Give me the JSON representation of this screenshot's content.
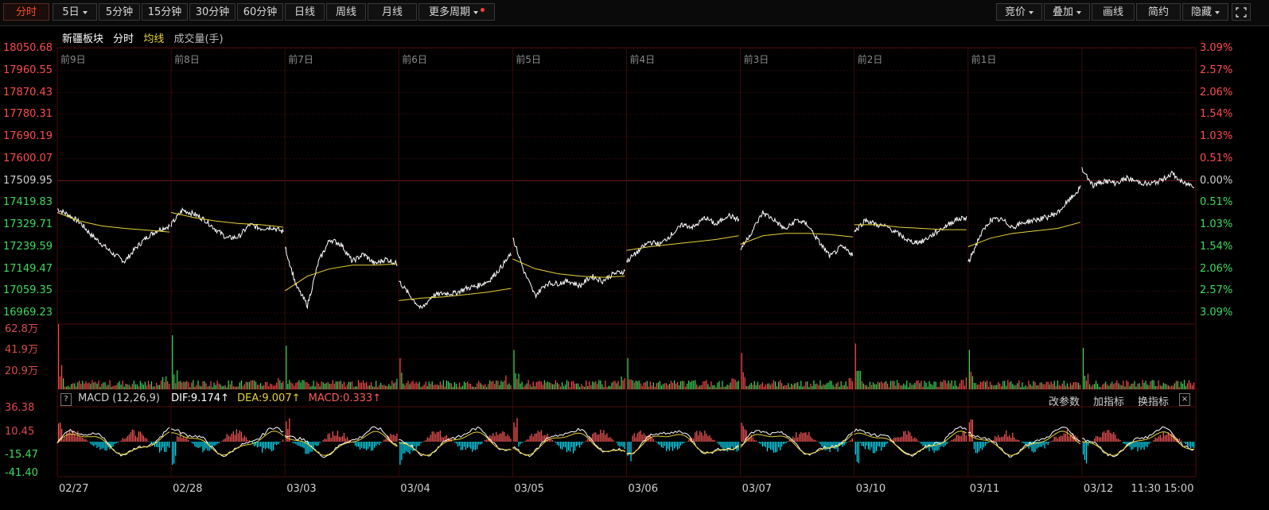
{
  "toolbar": {
    "periods": [
      "分时",
      "5日",
      "5分钟",
      "15分钟",
      "30分钟",
      "60分钟",
      "日线",
      "周线",
      "月线",
      "更多周期"
    ],
    "active": "分时",
    "right": [
      "竞价",
      "叠加",
      "画线",
      "简约",
      "隐藏"
    ],
    "fullscreen_icon": "expand-icon"
  },
  "legend": {
    "name": "新疆板块",
    "mode": "分时",
    "avg": "均线",
    "vol": "成交量(手)"
  },
  "colors": {
    "up": "#ff4d4d",
    "down": "#3ddc5a",
    "price": "#ffffff",
    "avg": "#e8d23a",
    "dif": "#ffffff",
    "dea": "#e8d23a",
    "macd_up": "#ff5a5a",
    "macd_down": "#00e5ff",
    "grid": "#3a0a0a"
  },
  "price_axis": {
    "left": [
      "18050.68",
      "17960.55",
      "17870.43",
      "17780.31",
      "17690.19",
      "17600.07",
      "17509.95",
      "17419.83",
      "17329.71",
      "17239.59",
      "17149.47",
      "17059.35",
      "16969.23"
    ],
    "right": [
      "3.09%",
      "2.57%",
      "2.06%",
      "1.54%",
      "1.03%",
      "0.51%",
      "0.00%",
      "0.51%",
      "1.03%",
      "1.54%",
      "2.06%",
      "2.57%",
      "3.09%"
    ]
  },
  "day_labels": [
    "前9日",
    "前8日",
    "前7日",
    "前6日",
    "前5日",
    "前4日",
    "前3日",
    "前2日",
    "前1日"
  ],
  "volume_axis": [
    "62.8万",
    "41.9万",
    "20.9万"
  ],
  "macd": {
    "title": "MACD (12,26,9)",
    "dif": "DIF:9.174↑",
    "dea": "DEA:9.007↑",
    "macd": "MACD:0.333↑",
    "tools": [
      "改参数",
      "加指标",
      "换指标"
    ],
    "axis": [
      "36.38",
      "10.45",
      "-15.47",
      "-41.40"
    ]
  },
  "x_labels": [
    "02/27",
    "02/28",
    "03/03",
    "03/04",
    "03/05",
    "03/06",
    "03/07",
    "03/10",
    "03/11",
    "03/12",
    "11:30",
    "15:00"
  ],
  "chart_data": {
    "type": "line",
    "title": "新疆板块",
    "reference_price": 17509.95,
    "ylim": [
      16969.23,
      18050.68
    ],
    "days": [
      {
        "label": "02/27",
        "price": [
          17395,
          17370,
          17340,
          17290,
          17250,
          17210,
          17180,
          17235,
          17280,
          17310,
          17325
        ],
        "avg": [
          17380,
          17345,
          17325,
          17315,
          17308,
          17300
        ]
      },
      {
        "label": "02/28",
        "price": [
          17330,
          17390,
          17375,
          17350,
          17310,
          17275,
          17280,
          17330,
          17315,
          17320,
          17300
        ],
        "avg": [
          17380,
          17360,
          17345,
          17335,
          17330,
          17320
        ]
      },
      {
        "label": "03/03",
        "price": [
          17240,
          17080,
          17000,
          17180,
          17270,
          17250,
          17180,
          17210,
          17170,
          17190,
          17170
        ],
        "avg": [
          17060,
          17120,
          17150,
          17165,
          17165,
          17170
        ]
      },
      {
        "label": "03/04",
        "price": [
          17100,
          17040,
          16985,
          17040,
          17050,
          17050,
          17070,
          17080,
          17100,
          17150,
          17210
        ],
        "avg": [
          17020,
          17030,
          17035,
          17045,
          17055,
          17070
        ]
      },
      {
        "label": "03/05",
        "price": [
          17280,
          17140,
          17040,
          17090,
          17090,
          17100,
          17080,
          17120,
          17100,
          17130,
          17140
        ],
        "avg": [
          17190,
          17150,
          17130,
          17120,
          17115,
          17120
        ]
      },
      {
        "label": "03/06",
        "price": [
          17180,
          17220,
          17260,
          17250,
          17290,
          17330,
          17320,
          17360,
          17330,
          17370,
          17350
        ],
        "avg": [
          17225,
          17240,
          17250,
          17260,
          17270,
          17285
        ]
      },
      {
        "label": "03/07",
        "price": [
          17230,
          17300,
          17380,
          17350,
          17310,
          17350,
          17330,
          17260,
          17200,
          17240,
          17210
        ],
        "avg": [
          17250,
          17285,
          17295,
          17295,
          17290,
          17280
        ]
      },
      {
        "label": "03/10",
        "price": [
          17300,
          17350,
          17330,
          17320,
          17290,
          17260,
          17260,
          17290,
          17320,
          17350,
          17360
        ],
        "avg": [
          17330,
          17330,
          17320,
          17315,
          17310,
          17310
        ]
      },
      {
        "label": "03/11",
        "price": [
          17170,
          17280,
          17350,
          17350,
          17320,
          17340,
          17350,
          17360,
          17380,
          17430,
          17480
        ],
        "avg": [
          17240,
          17275,
          17295,
          17305,
          17315,
          17340
        ]
      },
      {
        "label": "03/12",
        "price": [
          17560,
          17490,
          17510,
          17500,
          17520,
          17505,
          17495,
          17510,
          17540,
          17500,
          17490
        ],
        "avg": []
      }
    ],
    "volume_peak": [
      62.8,
      52,
      42,
      30,
      38,
      30,
      35,
      44,
      38,
      40
    ],
    "ylabel": "成交量(手)"
  }
}
